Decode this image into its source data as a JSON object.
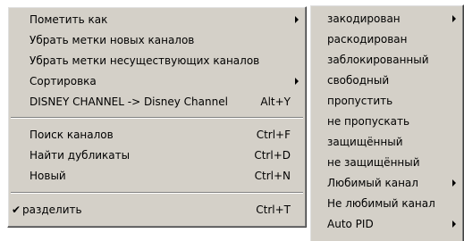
{
  "main_menu": {
    "items": [
      {
        "label": "Пометить как",
        "shortcut": ""
      },
      {
        "label": "Убрать метки новых каналов",
        "shortcut": ""
      },
      {
        "label": "Убрать метки несуществующих каналов",
        "shortcut": ""
      },
      {
        "label": "Сортировка",
        "shortcut": ""
      },
      {
        "label": "DISNEY CHANNEL -> Disney Channel",
        "shortcut": "Alt+Y"
      },
      {
        "label": "Поиск каналов",
        "shortcut": "Ctrl+F"
      },
      {
        "label": "Найти дубликаты",
        "shortcut": "Ctrl+D"
      },
      {
        "label": "Новый",
        "shortcut": "Ctrl+N"
      },
      {
        "label": "разделить",
        "shortcut": "Ctrl+T",
        "checked": true,
        "check_glyph": "✔"
      }
    ]
  },
  "submenu": {
    "items": [
      {
        "label": "закодирован"
      },
      {
        "label": "раскодирован"
      },
      {
        "label": "заблокированный"
      },
      {
        "label": "свободный"
      },
      {
        "label": "пропустить"
      },
      {
        "label": "не пропускать"
      },
      {
        "label": "защищённый"
      },
      {
        "label": "не защищённый"
      },
      {
        "label": "Любимый канал"
      },
      {
        "label": "Не любимый канал"
      },
      {
        "label": "Auto PID"
      }
    ]
  }
}
